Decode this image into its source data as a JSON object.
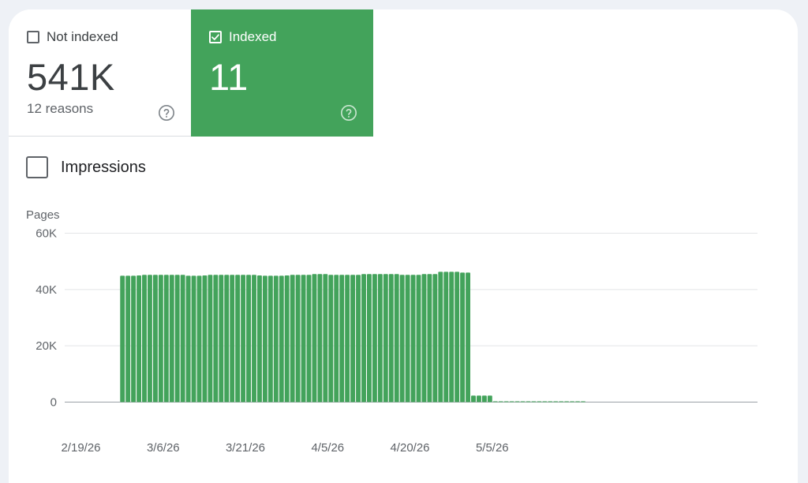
{
  "metrics": {
    "not_indexed": {
      "label": "Not indexed",
      "value": "541K",
      "subtitle": "12 reasons",
      "checked": false
    },
    "indexed": {
      "label": "Indexed",
      "value": "11",
      "checked": true
    }
  },
  "impressions": {
    "label": "Impressions",
    "checked": false
  },
  "colors": {
    "accent": "#43a35b",
    "bar": "#43a35b"
  },
  "icons": {
    "help": "help-circle-icon",
    "check": "checkmark-icon"
  },
  "chart_data": {
    "type": "bar",
    "ylabel": "Pages",
    "ylim": [
      0,
      60000
    ],
    "yticks": [
      {
        "value": 0,
        "label": "0"
      },
      {
        "value": 20000,
        "label": "20K"
      },
      {
        "value": 40000,
        "label": "40K"
      },
      {
        "value": 60000,
        "label": "60K"
      }
    ],
    "x_tick_labels": [
      {
        "index": 0,
        "label": "2/19/26"
      },
      {
        "index": 15,
        "label": "3/6/26"
      },
      {
        "index": 30,
        "label": "3/21/26"
      },
      {
        "index": 45,
        "label": "4/5/26"
      },
      {
        "index": 60,
        "label": "4/20/26"
      },
      {
        "index": 75,
        "label": "5/5/26"
      }
    ],
    "grid": true,
    "series": [
      {
        "values": [
          null,
          null,
          null,
          null,
          null,
          44900,
          44900,
          44900,
          45000,
          45200,
          45200,
          45200,
          45200,
          45200,
          45200,
          45200,
          45200,
          44900,
          44900,
          44900,
          45000,
          45200,
          45200,
          45200,
          45200,
          45200,
          45200,
          45200,
          45200,
          45200,
          45000,
          44900,
          44900,
          44900,
          44900,
          45000,
          45200,
          45200,
          45200,
          45200,
          45500,
          45500,
          45500,
          45200,
          45200,
          45200,
          45200,
          45200,
          45200,
          45500,
          45500,
          45500,
          45500,
          45500,
          45500,
          45500,
          45200,
          45200,
          45200,
          45200,
          45500,
          45500,
          45500,
          46300,
          46300,
          46300,
          46300,
          46000,
          46000,
          2300,
          2300,
          2300,
          2300,
          250,
          250,
          250,
          250,
          250,
          250,
          250,
          250,
          250,
          250,
          250,
          250,
          250,
          250,
          250,
          250,
          250
        ]
      }
    ]
  }
}
